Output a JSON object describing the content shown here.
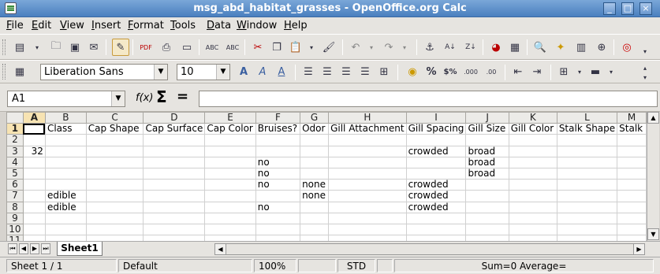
{
  "window": {
    "title": "msg_abd_habitat_grasses - OpenOffice.org Calc",
    "minimize_glyph": "_",
    "maximize_glyph": "□",
    "close_glyph": "×"
  },
  "menu": [
    "File",
    "Edit",
    "View",
    "Insert",
    "Format",
    "Tools",
    "Data",
    "Window",
    "Help"
  ],
  "formatting": {
    "font_name": "Liberation Sans",
    "font_size": "10"
  },
  "formula_bar": {
    "cell_ref": "A1",
    "function_icon": "f(x)",
    "sum_icon": "Σ",
    "equals_icon": "=",
    "content": ""
  },
  "grid": {
    "columns": [
      "A",
      "B",
      "C",
      "D",
      "E",
      "F",
      "G",
      "H",
      "I",
      "J",
      "K",
      "L",
      "M"
    ],
    "active_column": "A",
    "active_row": "1",
    "rows": [
      {
        "n": "1",
        "cells": [
          "",
          "Class",
          "Cap Shape",
          "Cap Surface",
          "Cap Color",
          "Bruises?",
          "Odor",
          "Gill Attachment",
          "Gill Spacing",
          "Gill Size",
          "Gill Color",
          "Stalk Shape",
          "Stalk"
        ]
      },
      {
        "n": "2",
        "cells": [
          "",
          "",
          "",
          "",
          "",
          "",
          "",
          "",
          "",
          "",
          "",
          "",
          ""
        ]
      },
      {
        "n": "3",
        "cells": [
          "32",
          "",
          "",
          "",
          "",
          "",
          "",
          "",
          "crowded",
          "broad",
          "",
          "",
          ""
        ]
      },
      {
        "n": "4",
        "cells": [
          "",
          "",
          "",
          "",
          "",
          "no",
          "",
          "",
          "",
          "broad",
          "",
          "",
          ""
        ]
      },
      {
        "n": "5",
        "cells": [
          "",
          "",
          "",
          "",
          "",
          "no",
          "",
          "",
          "",
          "broad",
          "",
          "",
          ""
        ]
      },
      {
        "n": "6",
        "cells": [
          "",
          "",
          "",
          "",
          "",
          "no",
          "none",
          "",
          "crowded",
          "",
          "",
          "",
          ""
        ]
      },
      {
        "n": "7",
        "cells": [
          "",
          "edible",
          "",
          "",
          "",
          "",
          "none",
          "",
          "crowded",
          "",
          "",
          "",
          ""
        ]
      },
      {
        "n": "8",
        "cells": [
          "",
          "edible",
          "",
          "",
          "",
          "no",
          "",
          "",
          "crowded",
          "",
          "",
          "",
          ""
        ]
      },
      {
        "n": "9",
        "cells": [
          "",
          "",
          "",
          "",
          "",
          "",
          "",
          "",
          "",
          "",
          "",
          "",
          ""
        ]
      },
      {
        "n": "10",
        "cells": [
          "",
          "",
          "",
          "",
          "",
          "",
          "",
          "",
          "",
          "",
          "",
          "",
          ""
        ]
      },
      {
        "n": "11",
        "cells": [
          "",
          "",
          "",
          "",
          "",
          "",
          "",
          "",
          "",
          "",
          "",
          "",
          ""
        ]
      }
    ]
  },
  "sheet_tabs": {
    "active": "Sheet1"
  },
  "statusbar": {
    "sheet": "Sheet 1 / 1",
    "page_style": "Default",
    "zoom": "100%",
    "selection_mode": "STD",
    "modified": "",
    "sum": "Sum=0 Average="
  }
}
